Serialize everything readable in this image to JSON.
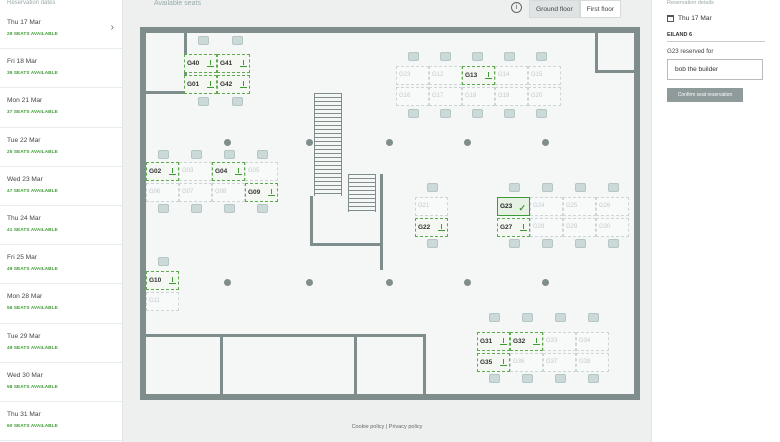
{
  "left": {
    "header": "Reservation dates",
    "days": [
      {
        "date": "Thu 17 Mar",
        "seats": "29 SEATS AVAILABLE"
      },
      {
        "date": "Fri 18 Mar",
        "seats": "39 SEATS AVAILABLE"
      },
      {
        "date": "Mon 21 Mar",
        "seats": "37 SEATS AVAILABLE"
      },
      {
        "date": "Tue 22 Mar",
        "seats": "25 SEATS AVAILABLE"
      },
      {
        "date": "Wed 23 Mar",
        "seats": "47 SEATS AVAILABLE"
      },
      {
        "date": "Thu 24 Mar",
        "seats": "41 SEATS AVAILABLE"
      },
      {
        "date": "Fri 25 Mar",
        "seats": "49 SEATS AVAILABLE"
      },
      {
        "date": "Mon 28 Mar",
        "seats": "56 SEATS AVAILABLE"
      },
      {
        "date": "Tue 29 Mar",
        "seats": "49 SEATS AVAILABLE"
      },
      {
        "date": "Wed 30 Mar",
        "seats": "58 SEATS AVAILABLE"
      },
      {
        "date": "Thu 31 Mar",
        "seats": "60 SEATS AVAILABLE"
      }
    ],
    "chevron": "chevron-right-icon"
  },
  "main": {
    "title": "Available seats",
    "info_icon": "info-icon",
    "floor_tabs": [
      "Ground floor",
      "First floor"
    ],
    "footer": "Cookie policy | Privacy policy"
  },
  "seats": {
    "G40": "G40",
    "G41": "G41",
    "G01": "G01",
    "G42": "G42",
    "G23a": "G23",
    "G12": "G12",
    "G13": "G13",
    "G14": "G14",
    "G15": "G15",
    "G16": "G16",
    "G17": "G17",
    "G18": "G18",
    "G19": "G19",
    "G20": "G20",
    "G02": "G02",
    "G03": "G03",
    "G04": "G04",
    "G05": "G05",
    "G06": "G06",
    "G07": "G07",
    "G08": "G08",
    "G09": "G09",
    "G21": "G21",
    "G22": "G22",
    "G23": "G23",
    "G24": "G24",
    "G25": "G25",
    "G26": "G26",
    "G27": "G27",
    "G28": "G28",
    "G29": "G29",
    "G30": "G30",
    "G10": "G10",
    "G11": "G11",
    "G31": "G31",
    "G32": "G32",
    "G33": "G33",
    "G34": "G34",
    "G35": "G35",
    "G36": "G36",
    "G37": "G37",
    "G38": "G38"
  },
  "right": {
    "header": "Reservation details",
    "date": "Thu 17 Mar",
    "room": "EILAND 6",
    "reserved_for": "G23 reserved for",
    "name_value": "bob the builder",
    "confirm_button": "Confirm seat reservation"
  }
}
